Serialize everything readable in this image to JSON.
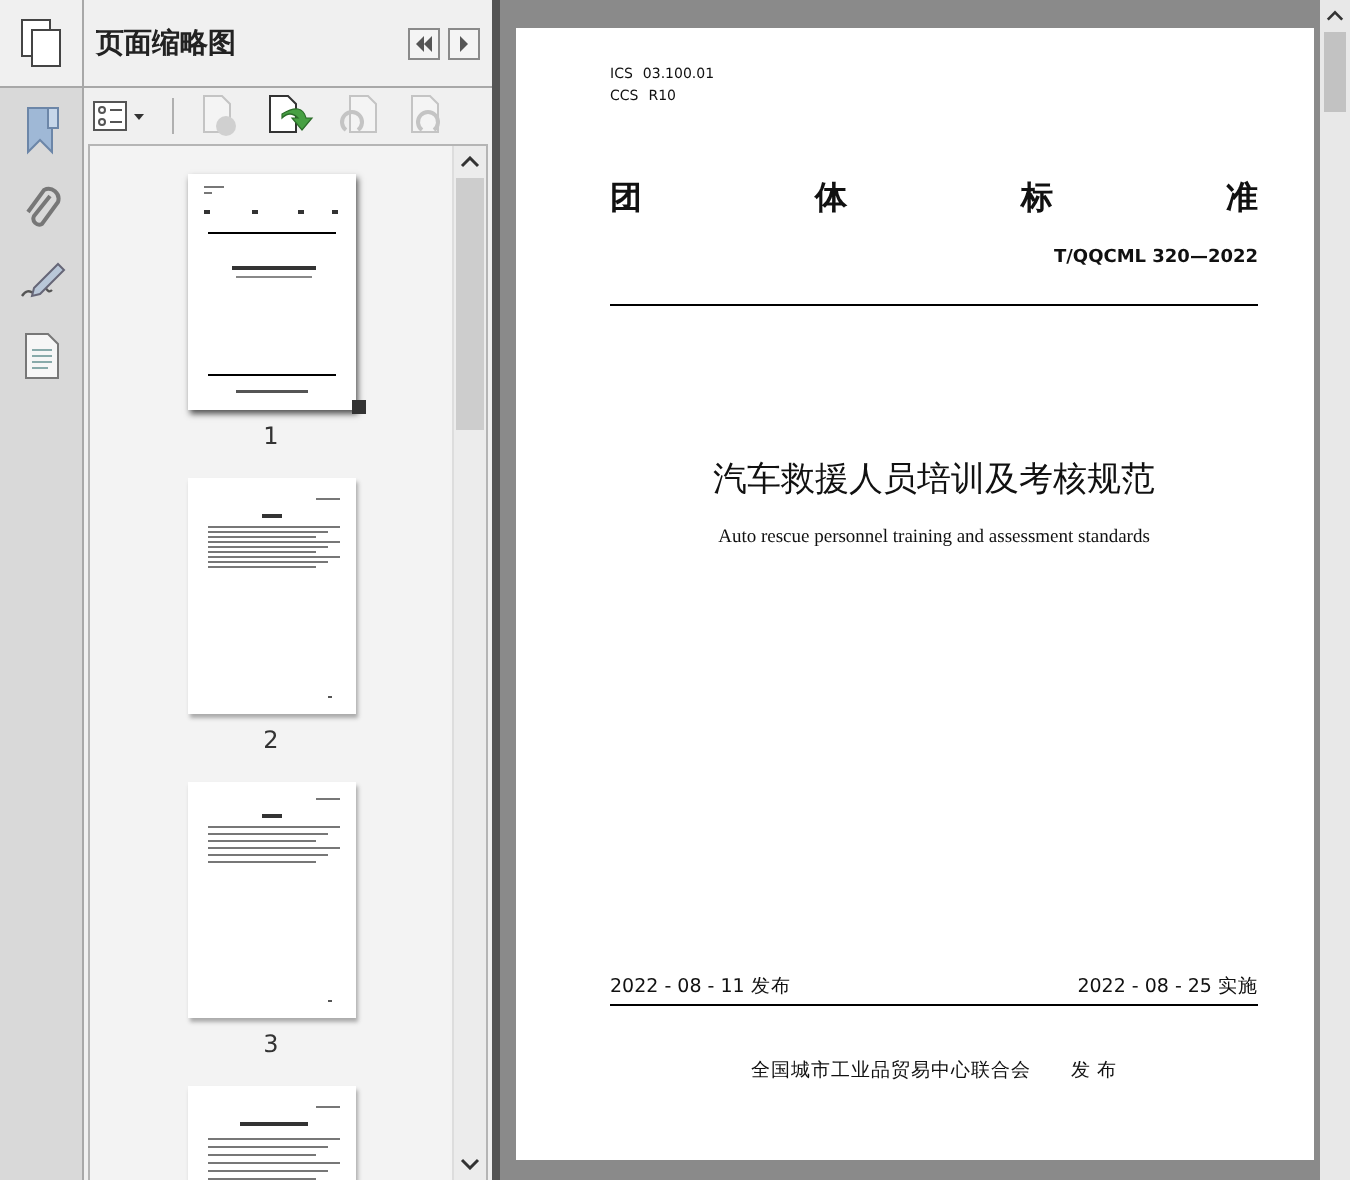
{
  "panel": {
    "title": "页面缩略图"
  },
  "thumbnails": [
    {
      "kind": "cover",
      "page": "1",
      "selected": true
    },
    {
      "kind": "contents",
      "page": "2",
      "selected": false
    },
    {
      "kind": "text",
      "page": "3",
      "selected": false
    },
    {
      "kind": "heading-text",
      "selected": false
    }
  ],
  "document": {
    "ics_label": "ICS",
    "ics_value": "03.100.01",
    "ccs_label": "CCS",
    "ccs_value": "R10",
    "category": [
      "团",
      "体",
      "标",
      "准"
    ],
    "code": "T/QQCML 320—2022",
    "title": "汽车救援人员培训及考核规范",
    "subtitle": "Auto rescue personnel training and assessment standards",
    "publish_date": "2022 - 08 - 11 发布",
    "effective_date": "2022 - 08 - 25 实施",
    "issuer": "全国城市工业品贸易中心联合会",
    "issuer_action": "发 布"
  }
}
